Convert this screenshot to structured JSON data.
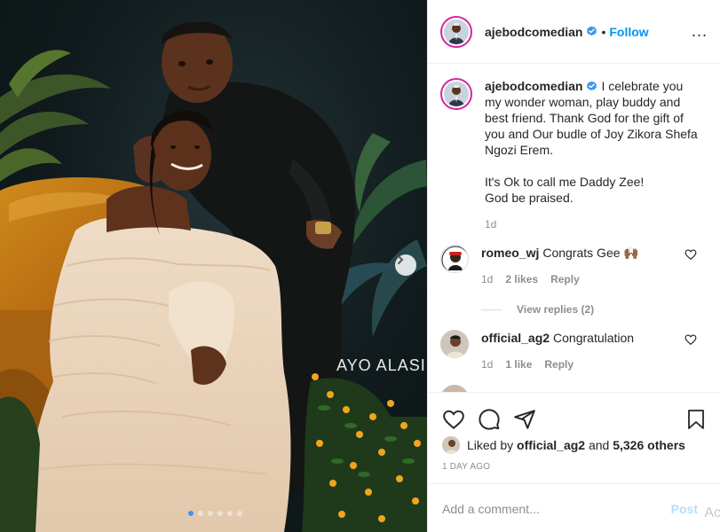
{
  "photo": {
    "watermark": "AYO ALASI",
    "carousel_dots": 6,
    "carousel_active": 1
  },
  "header": {
    "username": "ajebodcomedian",
    "bullet": "•",
    "follow_label": "Follow",
    "more_label": "..."
  },
  "caption": {
    "username": "ajebodcomedian",
    "lines": [
      "I celebrate you",
      "my wonder woman, play buddy and",
      "best friend. Thank God for the gift of",
      "you and Our budle of Joy Zikora Shefa",
      "Ngozi Erem.",
      "",
      "It's Ok to call me Daddy Zee!",
      "God be praised."
    ],
    "time": "1d"
  },
  "comments": [
    {
      "username": "romeo_wj",
      "text": "Congrats Gee 🙌🏾",
      "time": "1d",
      "likes": "2 likes",
      "reply": "Reply",
      "view_replies": "View replies (2)"
    },
    {
      "username": "official_ag2",
      "text": "Congratulation",
      "time": "1d",
      "likes": "1 like",
      "reply": "Reply"
    }
  ],
  "likes": {
    "prefix": "Liked by",
    "user": "official_ag2",
    "and": "and",
    "others": "5,326 others"
  },
  "post_age": "1 DAY AGO",
  "add_comment": {
    "placeholder": "Add a comment...",
    "post_label": "Post",
    "overlay": "Ac"
  },
  "colors": {
    "accent": "#0095f6",
    "verified": "#3897f0",
    "muted": "#8e8e8e",
    "text": "#262626"
  }
}
